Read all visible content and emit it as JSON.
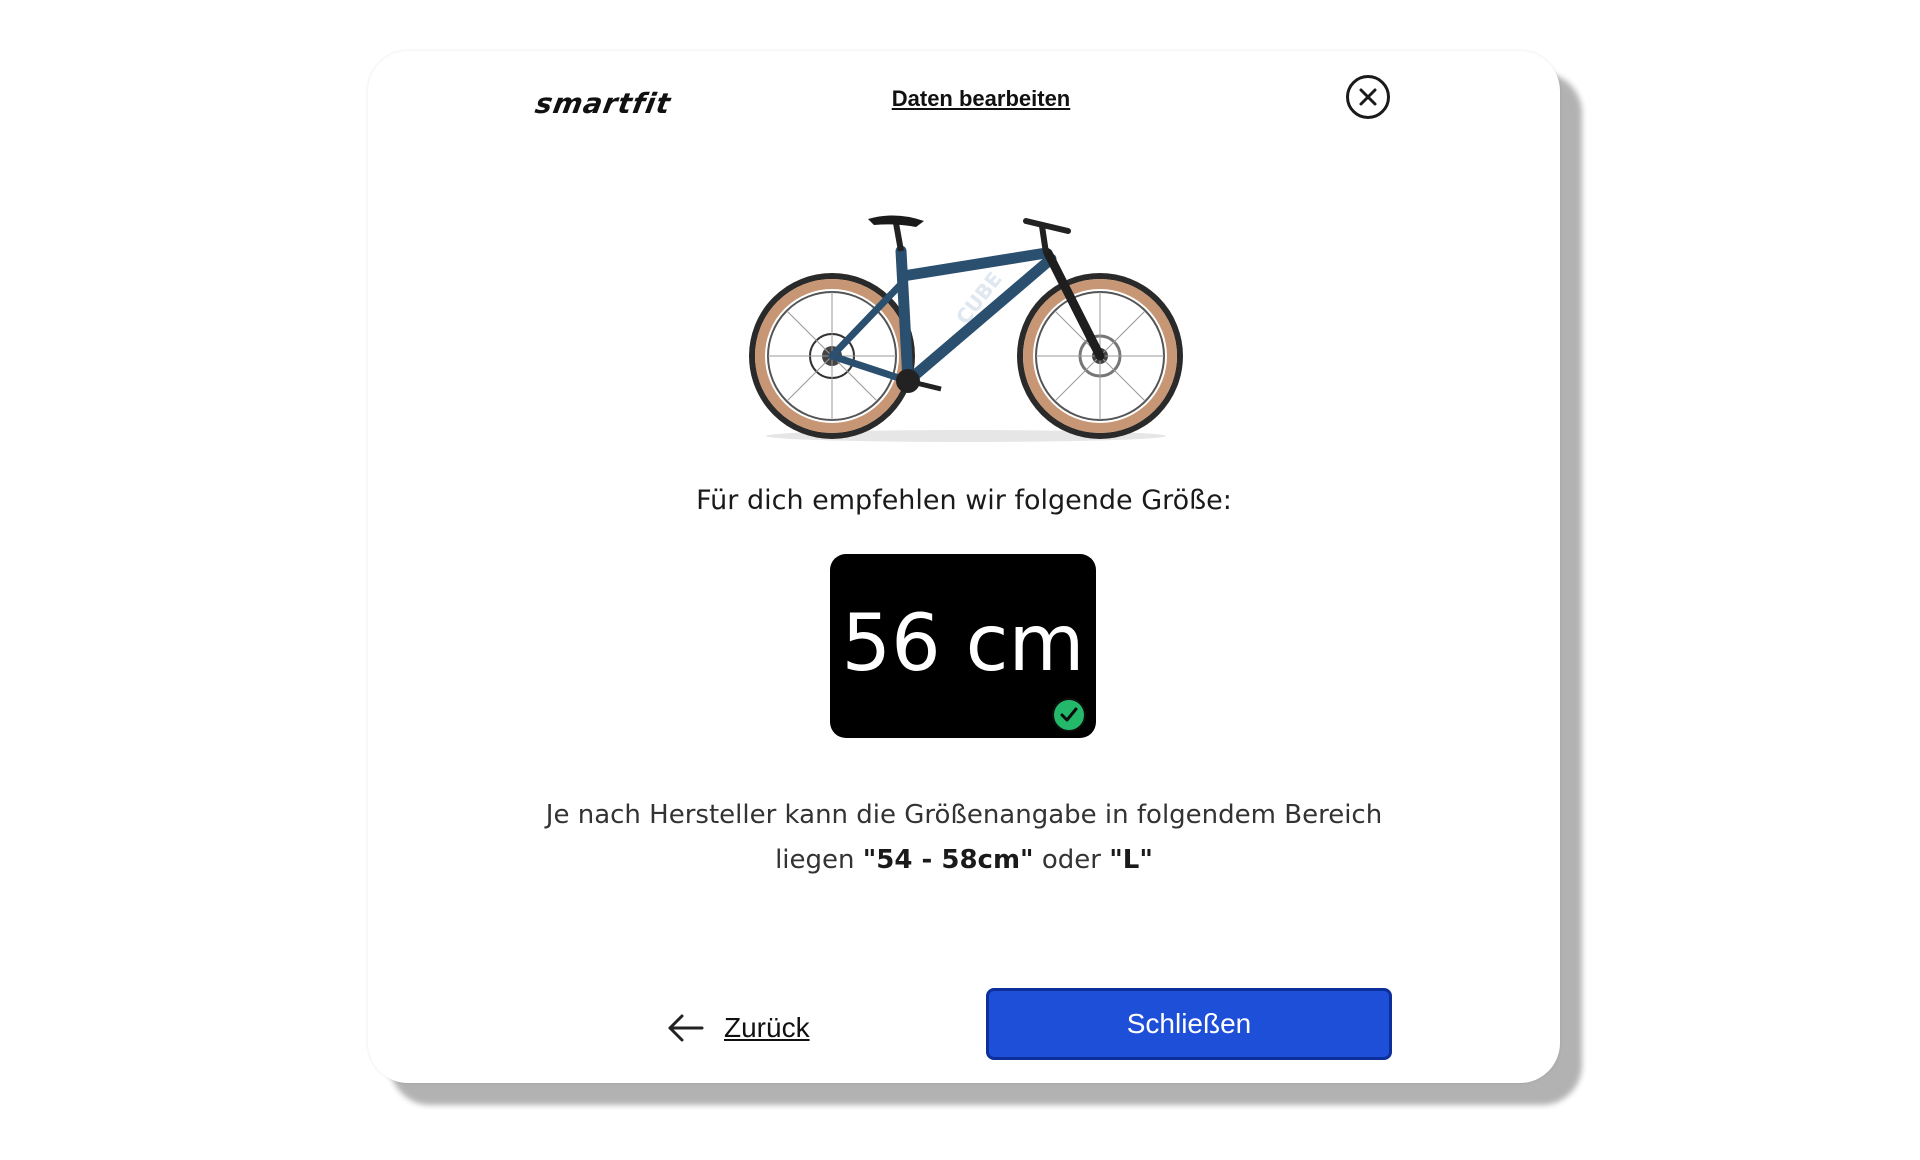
{
  "header": {
    "logo_text": "smartfit",
    "edit_link": "Daten bearbeiten",
    "close_icon": "close-circle-icon"
  },
  "product": {
    "image": "mountain-bike-image"
  },
  "recommendation": {
    "title": "Für dich empfehlen wir folgende Größe:",
    "size": "56 cm",
    "badge_icon": "check-icon",
    "badge_color": "#24b86a"
  },
  "range_info": {
    "text_1": "Je nach Hersteller kann die Größenangabe in folgendem Bereich liegen ",
    "value_cm": "\"54 - 58cm\"",
    "connector": " oder ",
    "value_letter": "\"L\""
  },
  "footer": {
    "back_icon": "arrow-left-icon",
    "back_label": "Zurück",
    "close_label": "Schließen",
    "primary_color": "#1e4fd8"
  }
}
